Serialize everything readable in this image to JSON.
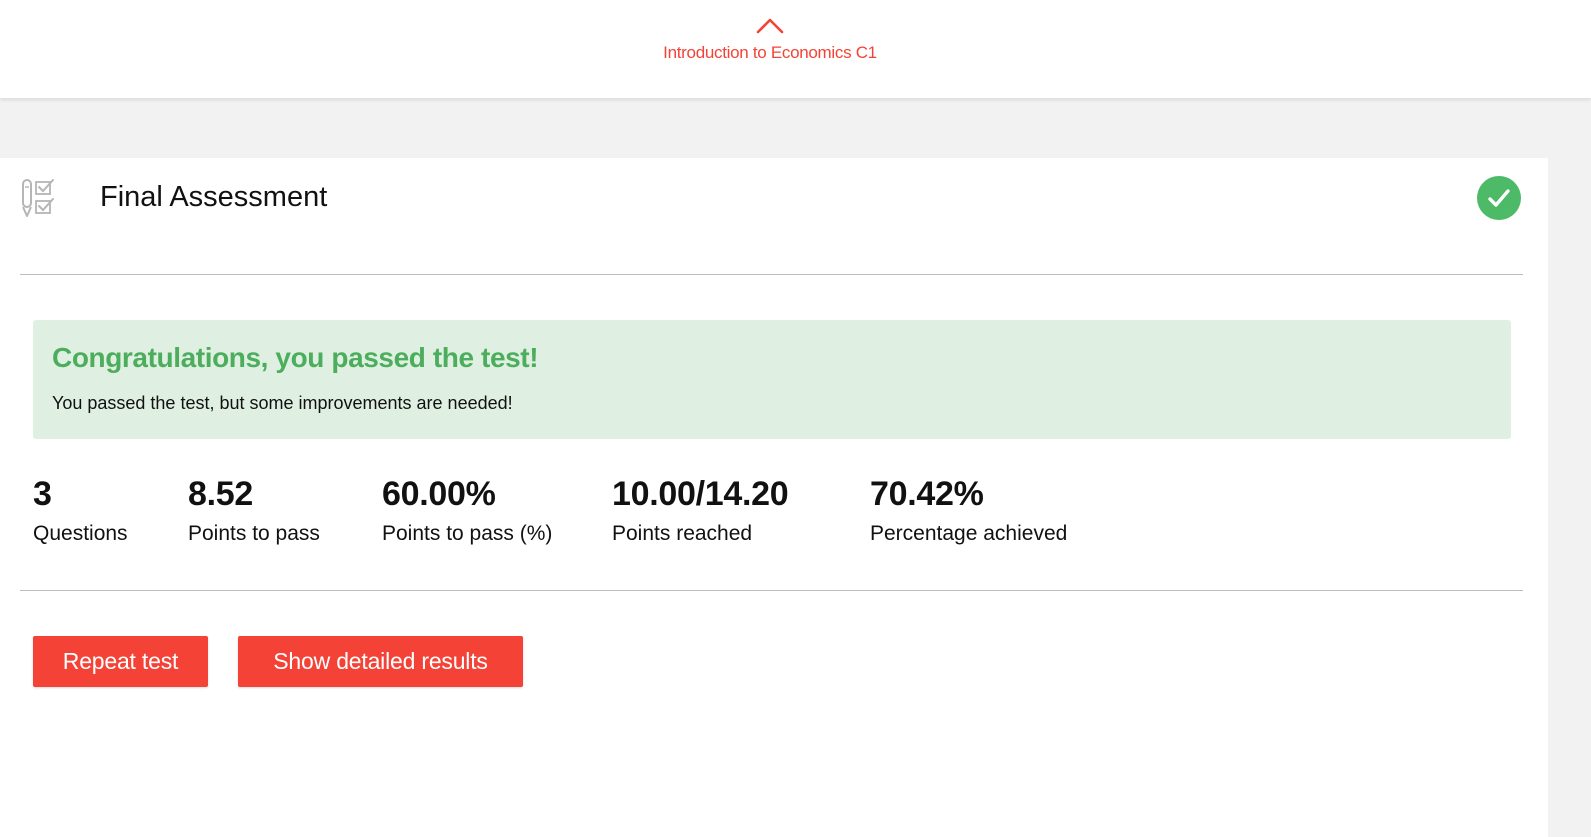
{
  "colors": {
    "accent": "#f44336",
    "success_green": "#4cba66",
    "success_bg": "#dff0e2",
    "page_bg": "#f2f2f2"
  },
  "topbar": {
    "nav_icon": "chevron-up-icon",
    "course_title": "Introduction to Economics C1"
  },
  "assessment": {
    "icon": "quiz-checklist-icon",
    "title": "Final Assessment",
    "status_icon": "check-icon"
  },
  "result": {
    "title": "Congratulations, you passed the test!",
    "message": "You passed the test, but some improvements are needed!"
  },
  "stats": [
    {
      "value": "3",
      "label": "Questions"
    },
    {
      "value": "8.52",
      "label": "Points to pass"
    },
    {
      "value": "60.00%",
      "label": "Points to pass (%)"
    },
    {
      "value": "10.00/14.20",
      "label": "Points reached"
    },
    {
      "value": "70.42%",
      "label": "Percentage achieved"
    }
  ],
  "actions": {
    "repeat_label": "Repeat test",
    "details_label": "Show detailed results"
  }
}
